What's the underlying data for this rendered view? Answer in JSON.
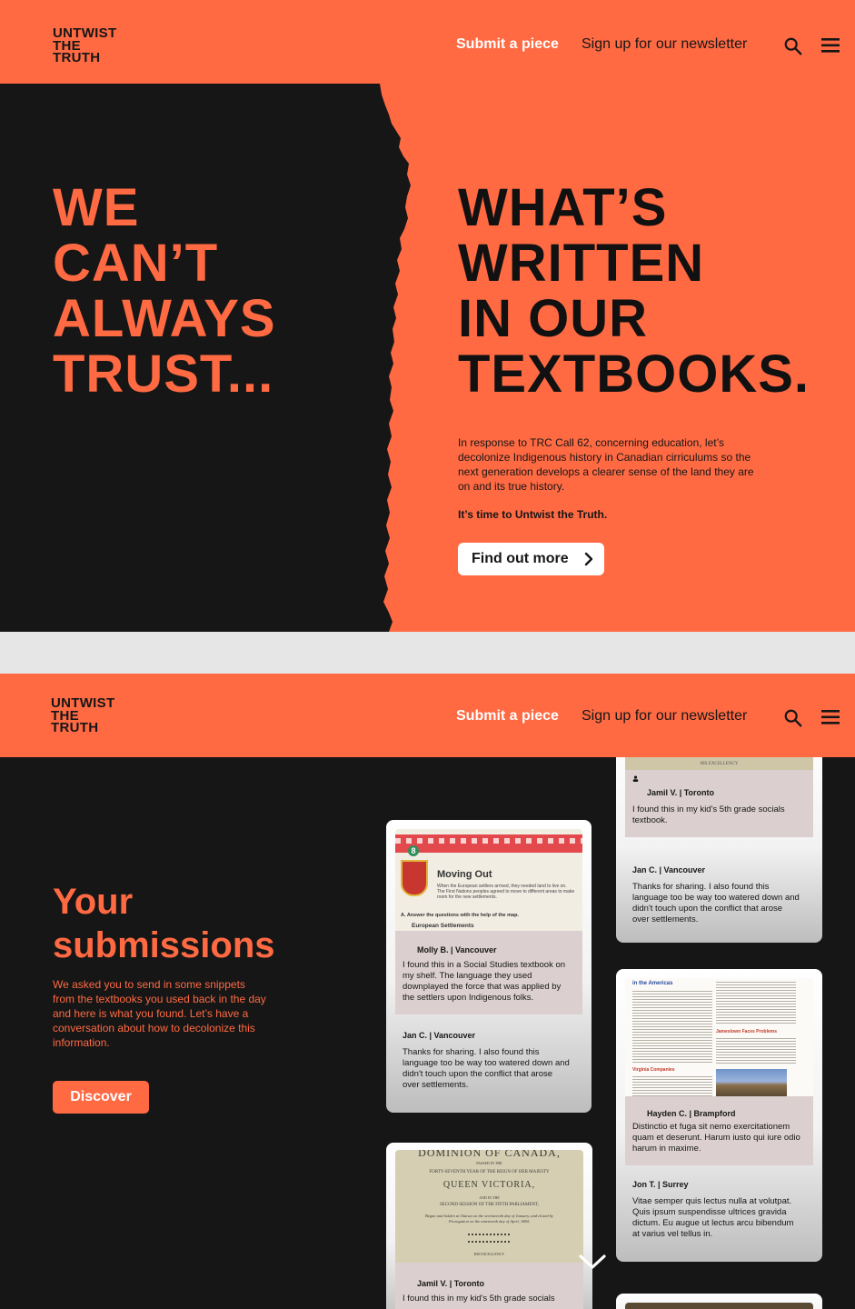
{
  "header": {
    "logo_lines": [
      "UNTWIST",
      "THE",
      "TRUTH"
    ],
    "nav_submit": "Submit a piece",
    "nav_newsletter": "Sign up for our newsletter",
    "search_icon": "search-icon",
    "menu_icon": "hamburger-menu-icon"
  },
  "hero": {
    "left_lines": [
      "WE",
      "CAN’T",
      "ALWAYS",
      "TRUST..."
    ],
    "right_lines": [
      "WHAT’S",
      "WRITTEN",
      "IN OUR",
      "TEXTBOOKS."
    ],
    "body": "In response to TRC Call 62, concerning education, let’s decolonize Indigenous history in Canadian cirriculums so the next generation develops a clearer sense of the land they are on and its true history.",
    "cta_text": "It’s time to Untwist the Truth.",
    "button_label": "Find out more",
    "colors": {
      "accent": "#ff6a43",
      "dark": "#161616"
    }
  },
  "submissions": {
    "title_lines": [
      "Your",
      "submissions"
    ],
    "body": "We asked you to send in some snippets from the textbooks you used back in the day and here is what you found. Let’s have a conversation about how to decolonize this information.",
    "button_label": "Discover",
    "cards": [
      {
        "photo_heading": "Moving Out",
        "photo_number": "8",
        "photo_text": "When the European settlers arrived, they needed land to live on. The First Nations peoples agreed to move to different areas to make room for the new settlements.",
        "photo_instruction": "A.  Answer the questions with the help of the map.",
        "photo_sub": "European Settlements",
        "author": "Molly B. | Vancouver",
        "message": "I found this in a Social Studies textbook on my shelf. The language they used downplayed the force that was applied by the settlers upon Indigenous folks.",
        "reply_author": "Jan C. | Vancouver",
        "reply_message": "Thanks for sharing. I also found this language too be way too watered down and didn't touch upon the conflict that arose over settlements."
      },
      {
        "photo_top_caption": "HIS EXCELLENCY",
        "author": "Jamil V. | Toronto",
        "message": "I found this in my kid's 5th grade socials textbook.",
        "reply_author": "Jan C. | Vancouver",
        "reply_message": "Thanks for sharing. I also found this language too be way too watered down and didn't touch upon the conflict that arose over settlements."
      },
      {
        "photo_heading": "in the Americas",
        "photo_sub1": "Jamestown Faces Problems",
        "photo_sub2": "Virginia Companies",
        "author": "Hayden C. | Brampford",
        "message": "Distinctio et fuga sit nemo exercitationem quam et deserunt. Harum iusto qui iure odio harum in maxime.",
        "reply_author": "Jon T. | Surrey",
        "reply_message": "Vitae semper quis lectus nulla at volutpat. Quis ipsum suspendisse ultrices gravida dictum. Eu augue ut lectus arcu bibendum at varius vel tellus in."
      },
      {
        "photo_title": "DOMINION OF CANADA,",
        "photo_line1": "PASSED IN THE",
        "photo_line2": "FORTY-SEVENTH YEAR OF THE REIGN OF HER MAJESTY",
        "photo_line3": "QUEEN VICTORIA,",
        "photo_line4": "AND IN THE",
        "photo_line5": "SECOND SESSION OF THE FIFTH PARLIAMENT,",
        "photo_line6": "Begun and holden at Ottawa on the seventeenth day of January, and closed by Prorogation on the nineteenth day of April, 1884.",
        "photo_line7": "HIS EXCELLENCY",
        "author": "Jamil V. | Toronto",
        "message": "I found this in my kid's 5th grade socials"
      }
    ],
    "scroll_icon": "chevron-down-icon"
  }
}
